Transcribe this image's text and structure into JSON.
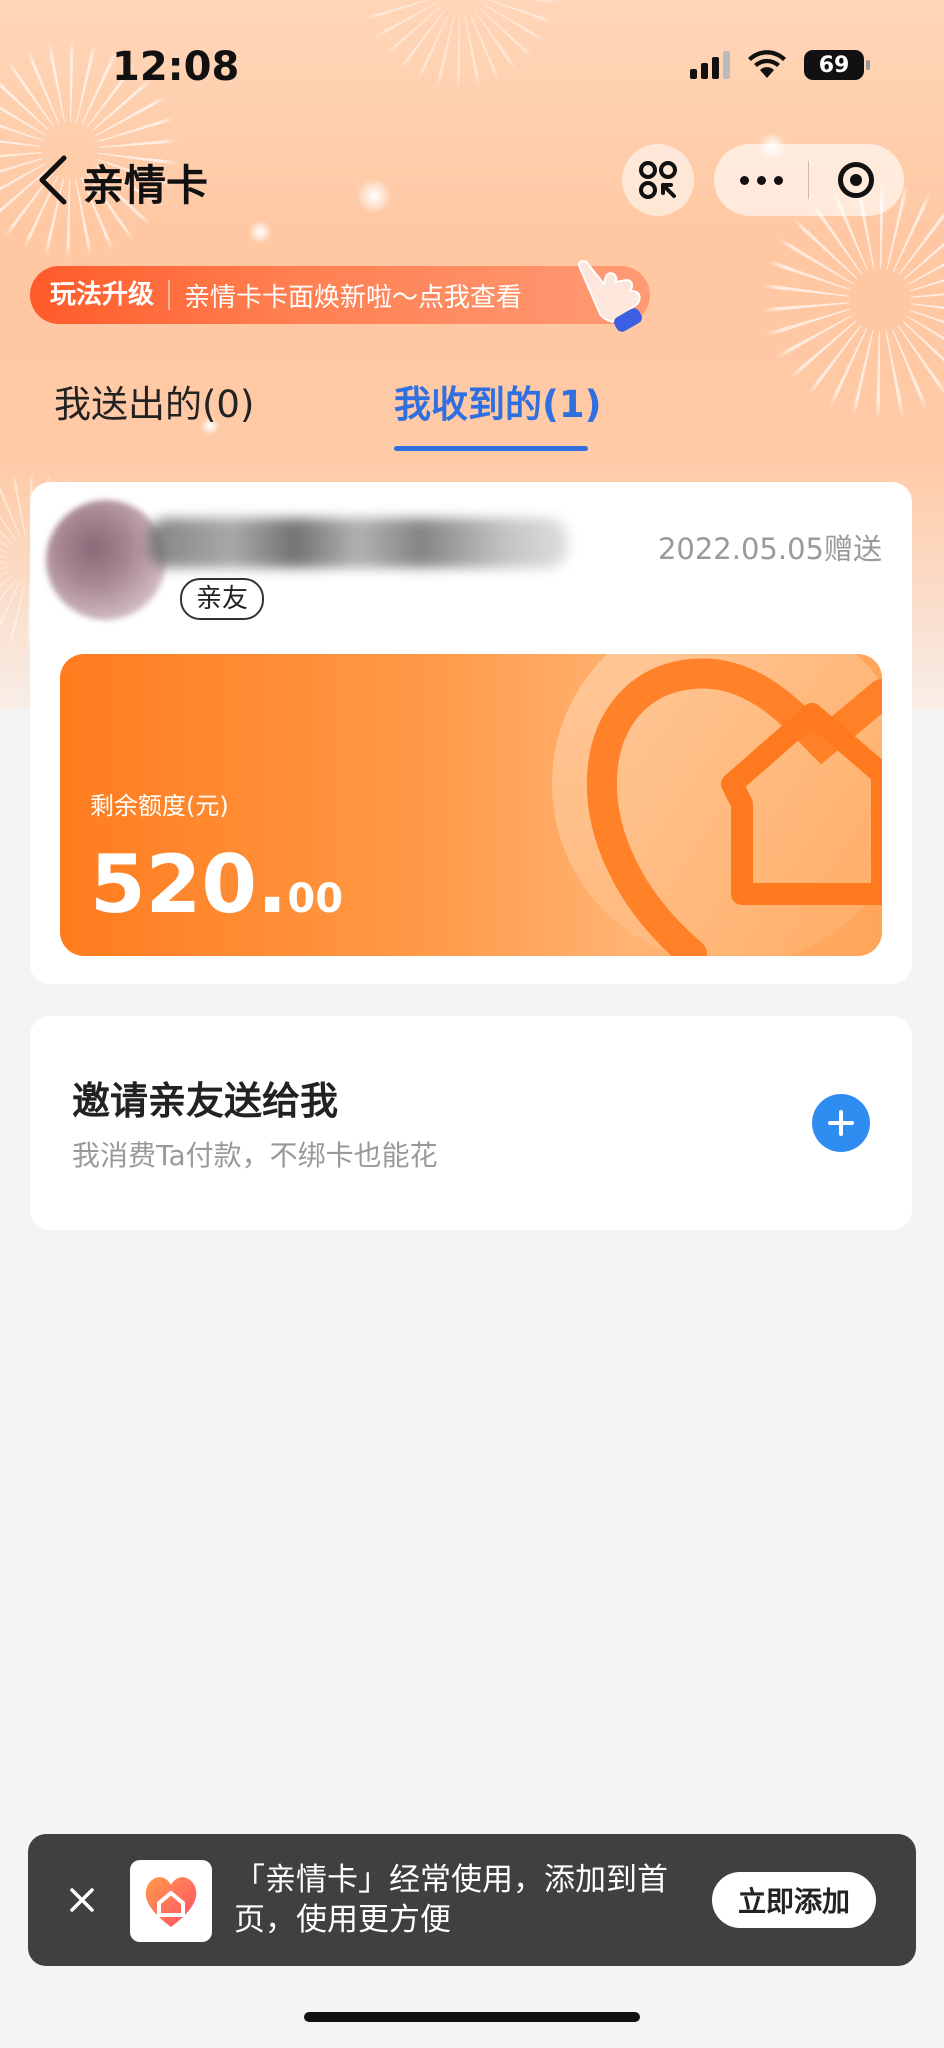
{
  "status_bar": {
    "time": "12:08",
    "battery": "69"
  },
  "nav": {
    "title": "亲情卡"
  },
  "promo": {
    "tag": "玩法升级",
    "text": "亲情卡卡面焕新啦～点我查看"
  },
  "tabs": [
    {
      "label": "我送出的(0)",
      "active": false
    },
    {
      "label": "我收到的(1)",
      "active": true
    }
  ],
  "received_card": {
    "relation": "亲友",
    "date": "2022.05.05赠送",
    "balance_label": "剩余额度(元)",
    "balance_integer": "520.",
    "balance_decimal": "00"
  },
  "invite": {
    "title": "邀请亲友送给我",
    "subtitle": "我消费Ta付款，不绑卡也能花"
  },
  "toast": {
    "text": "「亲情卡」经常使用，添加到首页，使用更方便",
    "button": "立即添加"
  },
  "colors": {
    "accent_blue": "#2f6fe0",
    "card_orange": "#ff7c1e",
    "toast_bg": "#404040"
  },
  "icons": [
    "chevron-left-icon",
    "scan-icon",
    "more-icon",
    "miniapp-close-icon",
    "hand-pointer-icon",
    "plus-icon",
    "close-icon",
    "family-heart-home-icon"
  ]
}
